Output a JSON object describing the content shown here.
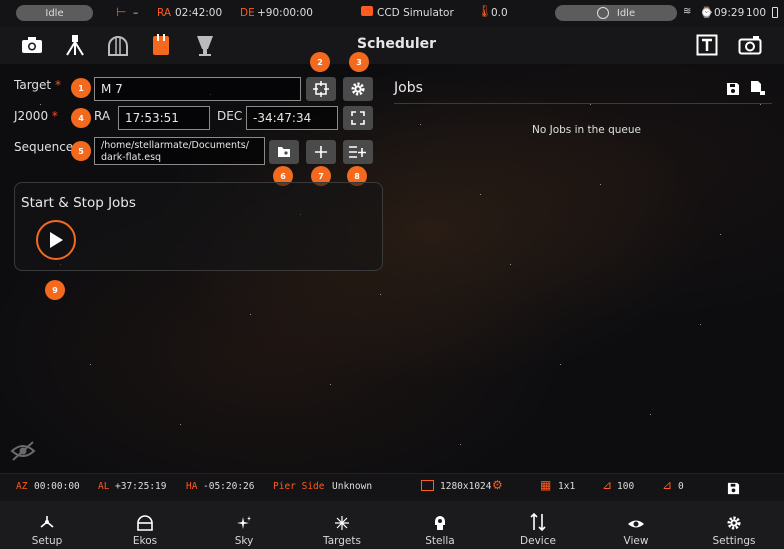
{
  "status_bar": {
    "left_status": "Idle",
    "mount_status": "–",
    "ra_label": "RA",
    "ra_value": "02:42:00",
    "de_label": "DE",
    "de_value": "+90:00:00",
    "camera_name": "CCD Simulator",
    "temperature": "0.0",
    "guide_status": "Idle",
    "time": "09:29",
    "battery": "100"
  },
  "toolbar": {
    "title": "Scheduler"
  },
  "form": {
    "target_label": "Target",
    "target_value": "M 7",
    "j2000_label": "J2000",
    "ra_label": "RA",
    "ra_value": "17:53:51",
    "dec_label": "DEC",
    "dec_value": "-34:47:34",
    "sequence_label": "Sequence",
    "sequence_value_line1": "/home/stellarmate/Documents/",
    "sequence_value_line2": "dark-flat.esq",
    "required_mark": "*"
  },
  "badges": [
    "1",
    "2",
    "3",
    "4",
    "5",
    "6",
    "7",
    "8",
    "9"
  ],
  "start_stop": {
    "title": "Start & Stop Jobs"
  },
  "jobs": {
    "title": "Jobs",
    "empty_text": "No Jobs in the queue"
  },
  "info_bar": {
    "az_label": "AZ",
    "az_value": "00:00:00",
    "al_label": "AL",
    "al_value": "+37:25:19",
    "ha_label": "HA",
    "ha_value": "-05:20:26",
    "pier_label": "Pier Side",
    "pier_value": "Unknown",
    "resolution": "1280x1024",
    "binning": "1x1",
    "gain": "100",
    "offset": "0"
  },
  "nav": {
    "items": [
      {
        "label": "Setup",
        "icon": "setup-icon"
      },
      {
        "label": "Ekos",
        "icon": "ekos-icon"
      },
      {
        "label": "Sky",
        "icon": "sky-icon"
      },
      {
        "label": "Targets",
        "icon": "targets-icon"
      },
      {
        "label": "Stella",
        "icon": "stella-icon"
      },
      {
        "label": "Device",
        "icon": "device-icon"
      },
      {
        "label": "View",
        "icon": "view-icon"
      },
      {
        "label": "Settings",
        "icon": "settings-icon"
      }
    ]
  },
  "colors": {
    "accent": "#f36a1e",
    "status_orange": "#ff5a1f",
    "background": "#0b0b0d"
  }
}
